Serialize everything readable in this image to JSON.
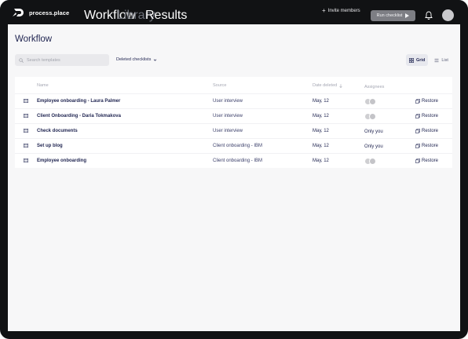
{
  "app": {
    "name": "process.place"
  },
  "nav": {
    "workflow": "Workflow",
    "library": "Library",
    "results": "Results"
  },
  "header": {
    "invite_label": "Invite members",
    "invite_plus": "+",
    "run_label": "Run checklist"
  },
  "page": {
    "title": "Workflow"
  },
  "toolbar": {
    "search_placeholder": "Search templates",
    "filter_label": "Deleted checklists",
    "grid_label": "Grid",
    "list_label": "List",
    "active_view": "grid"
  },
  "table": {
    "columns": {
      "name": "Name",
      "source": "Source",
      "date": "Date deleted",
      "assignees": "Assignees"
    },
    "rows": [
      {
        "name": "Employee onboarding - Laura Palmer",
        "source": "User interview",
        "date": "May, 12",
        "assignees": "",
        "restore": "Restore"
      },
      {
        "name": "Client Onboarding - Daria Tokmakova",
        "source": "User interview",
        "date": "May, 12",
        "assignees": "",
        "restore": "Restore"
      },
      {
        "name": "Check documents",
        "source": "User interview",
        "date": "May, 12",
        "assignees": "Only you",
        "restore": "Restore"
      },
      {
        "name": "Set up blog",
        "source": "Client onboarding - IBM",
        "date": "May, 12",
        "assignees": "Only you",
        "restore": "Restore"
      },
      {
        "name": "Employee onboarding",
        "source": "Client onboarding - IBM",
        "date": "May, 12",
        "assignees": "",
        "restore": "Restore"
      }
    ]
  },
  "colors": {
    "topbar": "#111214",
    "text_dark": "#1f2450",
    "content_bg": "#f7f7f8",
    "run_button": "#7d7e84"
  },
  "icons": [
    "logo-icon",
    "plus-icon",
    "play-icon",
    "bell-icon",
    "avatar",
    "search-icon",
    "chevron-down-icon",
    "grid-icon",
    "list-icon",
    "sort-down-icon",
    "document-icon",
    "restore-icon"
  ]
}
